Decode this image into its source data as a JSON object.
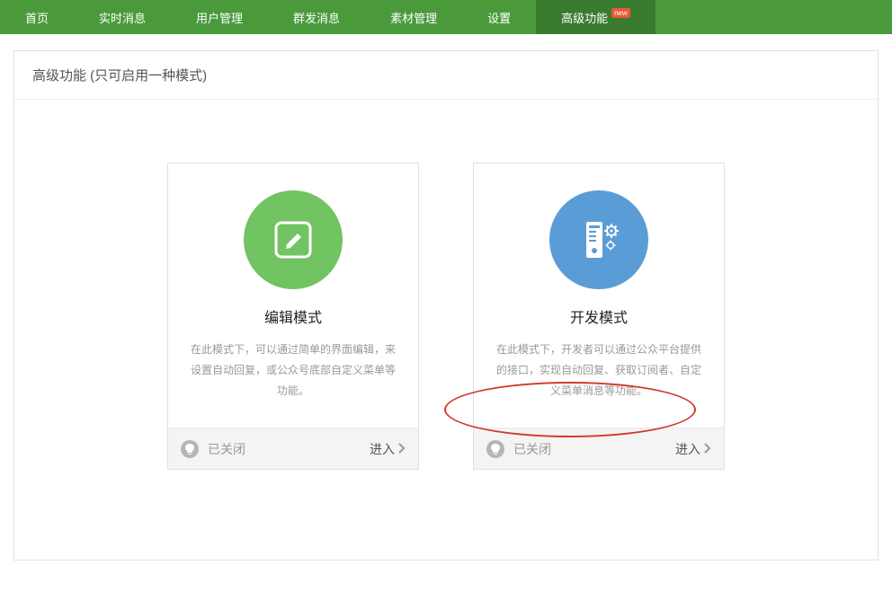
{
  "nav": {
    "items": [
      {
        "label": "首页",
        "active": false
      },
      {
        "label": "实时消息",
        "active": false
      },
      {
        "label": "用户管理",
        "active": false
      },
      {
        "label": "群发消息",
        "active": false
      },
      {
        "label": "素材管理",
        "active": false
      },
      {
        "label": "设置",
        "active": false
      },
      {
        "label": "高级功能",
        "active": true,
        "badge": "new"
      }
    ]
  },
  "page": {
    "title": "高级功能 (只可启用一种模式)"
  },
  "cards": {
    "edit": {
      "title": "编辑模式",
      "desc": "在此模式下，可以通过简单的界面编辑，来设置自动回复，或公众号底部自定义菜单等功能。",
      "status": "已关闭",
      "enter": "进入"
    },
    "dev": {
      "title": "开发模式",
      "desc": "在此模式下，开发者可以通过公众平台提供的接口，实现自动回复、获取订阅者、自定义菜单消息等功能。",
      "status": "已关闭",
      "enter": "进入"
    }
  }
}
